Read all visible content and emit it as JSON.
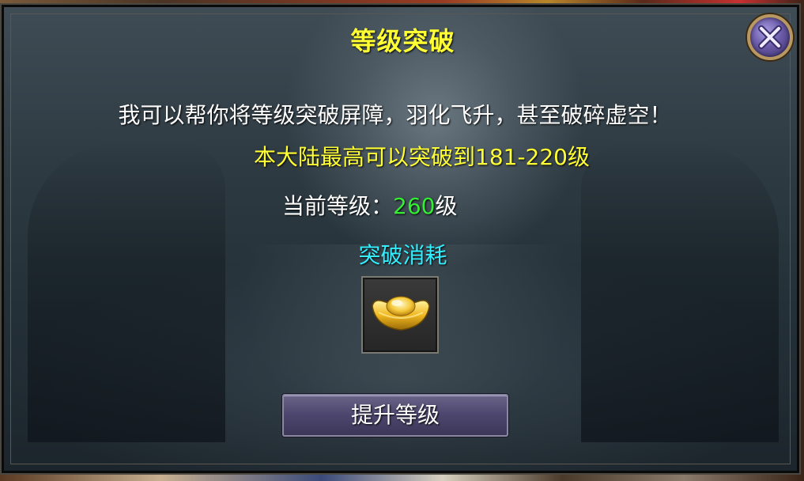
{
  "dialog": {
    "title": "等级突破",
    "description": "我可以帮你将等级突破屏障，羽化飞升，甚至破碎虚空！",
    "max_level_text": "本大陆最高可以突破到181-220级",
    "current_level": {
      "label": "当前等级：",
      "value": "260",
      "unit": "级"
    },
    "cost_label": "突破消耗",
    "cost_item": {
      "icon": "gold-ingot-icon"
    },
    "upgrade_button_label": "提升等级",
    "close_icon": "close-icon"
  },
  "colors": {
    "title": "#ffff33",
    "highlight_yellow": "#ffff33",
    "level_value": "#33ee33",
    "cost_label": "#33eeff",
    "button_bg": "#4e4870"
  }
}
